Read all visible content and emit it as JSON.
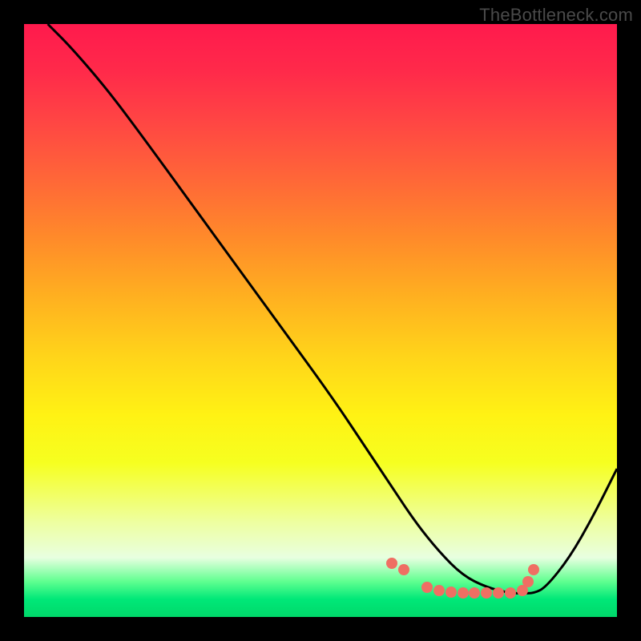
{
  "watermark": "TheBottleneck.com",
  "chart_data": {
    "type": "line",
    "title": "",
    "xlabel": "",
    "ylabel": "",
    "xlim": [
      0,
      100
    ],
    "ylim": [
      0,
      100
    ],
    "series": [
      {
        "name": "curve",
        "x": [
          4,
          8,
          14,
          20,
          28,
          36,
          44,
          52,
          58,
          62,
          66,
          70,
          74,
          78,
          82,
          84,
          86,
          88,
          92,
          96,
          100
        ],
        "y": [
          100,
          96,
          89,
          81,
          70,
          59,
          48,
          37,
          28,
          22,
          16,
          11,
          7,
          5,
          4,
          4,
          4,
          5,
          10,
          17,
          25
        ]
      }
    ],
    "markers": {
      "name": "highlighted-points",
      "x": [
        62,
        64,
        68,
        70,
        72,
        74,
        76,
        78,
        80,
        82,
        84,
        85,
        86
      ],
      "y": [
        9,
        8,
        5,
        4.5,
        4.2,
        4,
        4,
        4,
        4,
        4,
        4.5,
        6,
        8
      ]
    },
    "background_gradient": {
      "top": "#ff1a4d",
      "mid": "#ffd41a",
      "bottom": "#00d86a"
    }
  }
}
